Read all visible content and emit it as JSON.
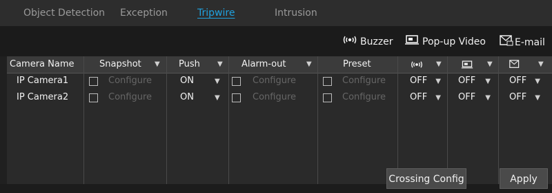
{
  "tabs": [
    {
      "label": "Object Detection",
      "active": false
    },
    {
      "label": "Exception",
      "active": false
    },
    {
      "label": "Tripwire",
      "active": true
    },
    {
      "label": "Intrusion",
      "active": false
    }
  ],
  "toolbar": {
    "buzzer": {
      "label": "Buzzer",
      "icon": "buzzer-icon"
    },
    "popup": {
      "label": "Pop-up Video",
      "icon": "popup-video-icon"
    },
    "email": {
      "label": "E-mail",
      "icon": "email-icon"
    }
  },
  "table": {
    "headers": {
      "camera": "Camera Name",
      "snapshot": "Snapshot",
      "push": "Push",
      "alarm_out": "Alarm-out",
      "preset": "Preset"
    },
    "rows": [
      {
        "camera": "IP Camera1",
        "snapshot": "Configure",
        "push": "ON",
        "alarm_out": "Configure",
        "preset": "Configure",
        "buzzer": "OFF",
        "popup": "OFF",
        "email": "OFF"
      },
      {
        "camera": "IP Camera2",
        "snapshot": "Configure",
        "push": "ON",
        "alarm_out": "Configure",
        "preset": "Configure",
        "buzzer": "OFF",
        "popup": "OFF",
        "email": "OFF"
      }
    ]
  },
  "buttons": {
    "crossing_config": "Crossing Config",
    "apply": "Apply"
  },
  "colors": {
    "active_tab": "#1fa2e0",
    "disabled_text": "#666666"
  }
}
